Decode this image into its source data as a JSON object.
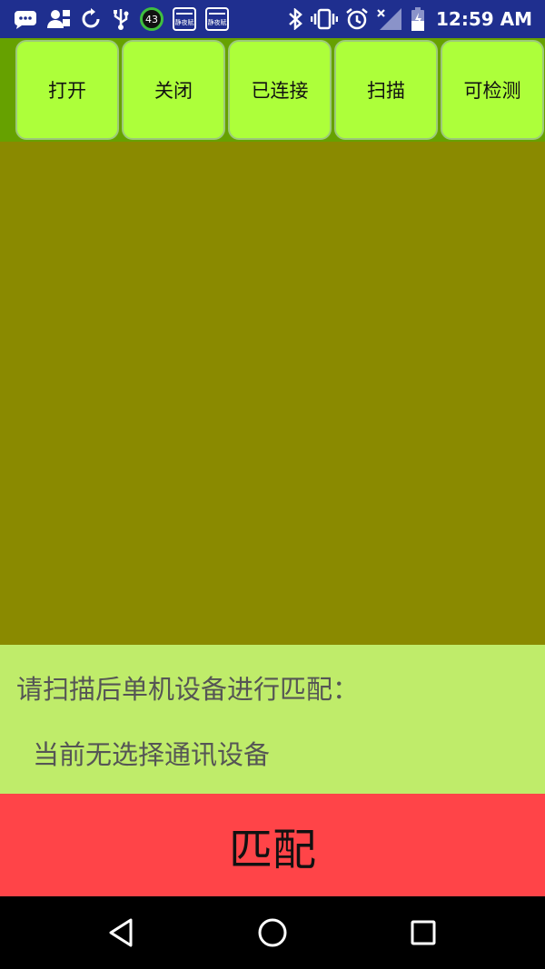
{
  "status_bar": {
    "time": "12:59 AM",
    "badge_count": "43",
    "calendar_label": "静夜赋",
    "icons": [
      "chat-icon",
      "user-upload-icon",
      "sync-icon",
      "usb-icon",
      "counter-badge",
      "calendar-icon",
      "calendar-icon",
      "bluetooth-icon",
      "vibrate-icon",
      "alarm-icon",
      "signal-icon",
      "battery-icon"
    ]
  },
  "toolbar": {
    "buttons": [
      {
        "label": "打开"
      },
      {
        "label": "关闭"
      },
      {
        "label": "已连接"
      },
      {
        "label": "扫描"
      },
      {
        "label": "可检测"
      }
    ]
  },
  "info": {
    "title": "请扫描后单机设备进行匹配：",
    "status": "当前无选择通讯设备"
  },
  "pair_button": {
    "label": "匹配"
  },
  "nav_bar": {
    "icons": [
      "back-icon",
      "home-icon",
      "recents-icon"
    ]
  },
  "colors": {
    "status_bar": "#1f2f8f",
    "toolbar": "#66a100",
    "button": "#adff3a",
    "list_area": "#8a8a00",
    "info_panel": "#bfec6a",
    "pair_button": "#ff4448"
  }
}
